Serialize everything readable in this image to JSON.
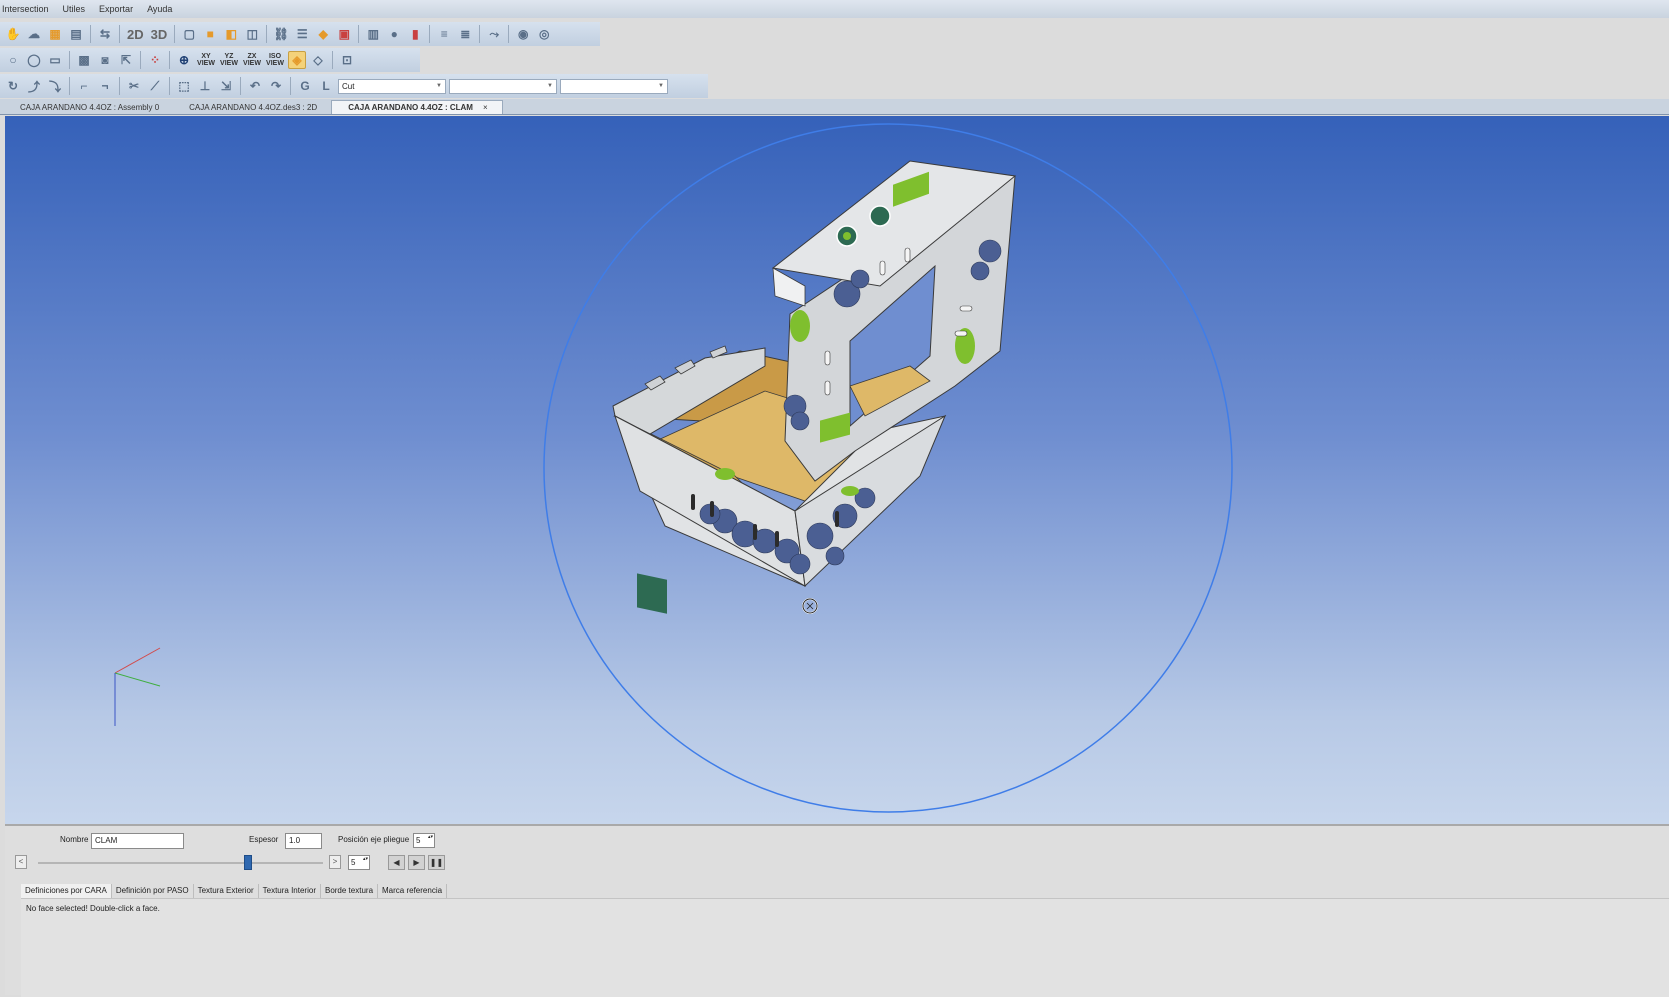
{
  "menu": {
    "items": [
      "Intersection",
      "Utiles",
      "Exportar",
      "Ayuda"
    ]
  },
  "toolbar1": {
    "view2d": "2D",
    "view3d": "3D"
  },
  "toolbar2": {
    "xy_view": "XY VIEW",
    "yz_view": "YZ VIEW",
    "zx_view": "ZX VIEW",
    "iso_view": "ISO VIEW"
  },
  "toolbar3": {
    "combo1_value": "Cut",
    "combo2_value": "",
    "combo3_value": ""
  },
  "doc_tabs": [
    {
      "label": "CAJA ARANDANO 4.4OZ : Assembly 0"
    },
    {
      "label": "CAJA ARANDANO 4.4OZ.des3 : 2D"
    },
    {
      "label": "CAJA ARANDANO 4.4OZ : CLAM",
      "active": true
    }
  ],
  "panel": {
    "nombre_label": "Nombre",
    "nombre_value": "CLAM",
    "espesor_label": "Espesor",
    "espesor_value": "1.0",
    "posicion_label": "Posición eje pliegue",
    "posicion_value": "5",
    "step_value": "5",
    "slider_prev": "<",
    "slider_next": ">"
  },
  "sub_tabs": [
    "Definiciones por CARA",
    "Definición por PASO",
    "Textura Exterior",
    "Textura Interior",
    "Borde textura",
    "Marca referencia"
  ],
  "status_message": "No face selected! Double-click a face.",
  "colors": {
    "viewport_top": "#3561b9",
    "viewport_bottom": "#c7d6ec",
    "box_outer": "#d9dcdf",
    "box_inner": "#d8b060",
    "accent_green": "#7fbf2e",
    "dark_green": "#2d6a52",
    "blueberry": "#4b5f93"
  }
}
